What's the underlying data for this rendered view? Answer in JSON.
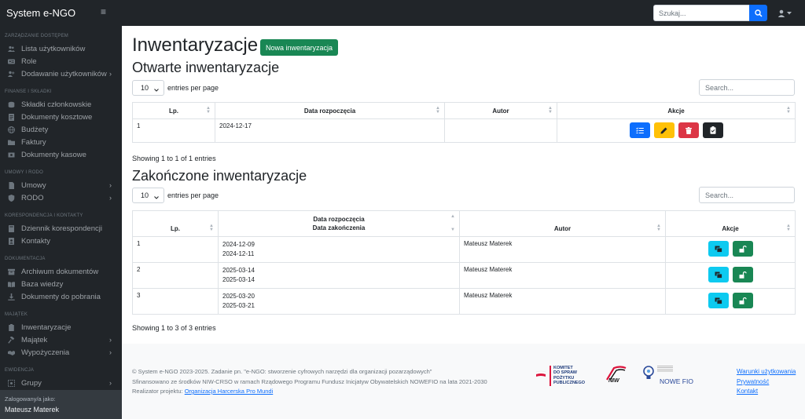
{
  "brand": "System e-NGO",
  "search": {
    "placeholder": "Szukaj..."
  },
  "sidebar": {
    "sections": [
      {
        "heading": "ZARZĄDZANIE DOSTĘPEM",
        "items": [
          {
            "label": "Lista użytkowników",
            "icon": "users-icon",
            "chevron": false
          },
          {
            "label": "Role",
            "icon": "id-card-icon",
            "chevron": false
          },
          {
            "label": "Dodawanie użytkowników",
            "icon": "user-plus-icon",
            "chevron": true
          }
        ]
      },
      {
        "heading": "FINANSE I SKŁADKI",
        "items": [
          {
            "label": "Składki członkowskie",
            "icon": "coins-icon",
            "chevron": false
          },
          {
            "label": "Dokumenty kosztowe",
            "icon": "receipt-icon",
            "chevron": false
          },
          {
            "label": "Budżety",
            "icon": "globe-icon",
            "chevron": false
          },
          {
            "label": "Faktury",
            "icon": "folder-icon",
            "chevron": false
          },
          {
            "label": "Dokumenty kasowe",
            "icon": "cash-register-icon",
            "chevron": false
          }
        ]
      },
      {
        "heading": "UMOWY I RODO",
        "items": [
          {
            "label": "Umowy",
            "icon": "document-icon",
            "chevron": true
          },
          {
            "label": "RODO",
            "icon": "shield-icon",
            "chevron": true
          }
        ]
      },
      {
        "heading": "KORESPONDENCJA I KONTAKTY",
        "items": [
          {
            "label": "Dziennik korespondencji",
            "icon": "book-icon",
            "chevron": false
          },
          {
            "label": "Kontakty",
            "icon": "address-book-icon",
            "chevron": false
          }
        ]
      },
      {
        "heading": "DOKUMENTACJA",
        "items": [
          {
            "label": "Archiwum dokumentów",
            "icon": "archive-icon",
            "chevron": false
          },
          {
            "label": "Baza wiedzy",
            "icon": "open-book-icon",
            "chevron": false
          },
          {
            "label": "Dokumenty do pobrania",
            "icon": "download-icon",
            "chevron": false
          }
        ]
      },
      {
        "heading": "MAJĄTEK",
        "items": [
          {
            "label": "Inwentaryzacje",
            "icon": "clipboard-icon",
            "chevron": false
          },
          {
            "label": "Majątek",
            "icon": "gavel-icon",
            "chevron": true
          },
          {
            "label": "Wypożyczenia",
            "icon": "handshake-icon",
            "chevron": true
          }
        ]
      },
      {
        "heading": "EWIDENCJA",
        "items": [
          {
            "label": "Grupy",
            "icon": "group-icon",
            "chevron": true
          }
        ]
      }
    ],
    "logged_as_label": "Zalogowany/a jako:",
    "user_name": "Mateusz Materek"
  },
  "page": {
    "title": "Inwentaryzacje",
    "new_button": "Nowa inwentaryzacja"
  },
  "open_section": {
    "title": "Otwarte inwentaryzacje",
    "length_value": "10",
    "length_label": "entries per page",
    "search_placeholder": "Search...",
    "columns": [
      "Lp.",
      "Data rozpoczęcia",
      "Autor",
      "Akcje"
    ],
    "rows": [
      {
        "lp": "1",
        "start": "2024-12-17",
        "author": ""
      }
    ],
    "info": "Showing 1 to 1 of 1 entries"
  },
  "closed_section": {
    "title": "Zakończone inwentaryzacje",
    "length_value": "10",
    "length_label": "entries per page",
    "search_placeholder": "Search...",
    "columns": [
      "Lp.",
      "Data rozpoczęcia",
      "Data zakończenia",
      "Autor",
      "Akcje"
    ],
    "rows": [
      {
        "lp": "1",
        "start": "2024-12-09",
        "end": "2024-12-11",
        "author": "Mateusz Materek"
      },
      {
        "lp": "2",
        "start": "2025-03-14",
        "end": "2025-03-14",
        "author": "Mateusz Materek"
      },
      {
        "lp": "3",
        "start": "2025-03-20",
        "end": "2025-03-21",
        "author": "Mateusz Materek"
      }
    ],
    "info": "Showing 1 to 3 of 3 entries"
  },
  "footer": {
    "line1": "© System e-NGO 2023-2025. Zadanie pn. \"e-NGO: stworzenie cyfrowych narzędzi dla organizacji pozarządowych\"",
    "line2": "Sfinansowano ze środków NIW-CRSO w ramach Rządowego Programu Fundusz Inicjatyw Obywatelskich NOWEFIO na lata 2021-2030",
    "line3_prefix": "Realizator projektu: ",
    "line3_link": "Organizacja Harcerska Pro Mundi",
    "links": [
      "Warunki użytkowania",
      "Prywatność",
      "Kontakt"
    ],
    "logo_komitet": [
      "KOMITET",
      "DO SPRAW",
      "POŻYTKU",
      "PUBLICZNEGO"
    ],
    "logo_niw": "NIW",
    "logo_fio": "NOWE FIO"
  },
  "colors": {
    "navbar": "#212529",
    "primary": "#0d6efd",
    "success": "#198754",
    "warning": "#ffc107",
    "danger": "#dc3545",
    "info": "#0dcaf0"
  }
}
